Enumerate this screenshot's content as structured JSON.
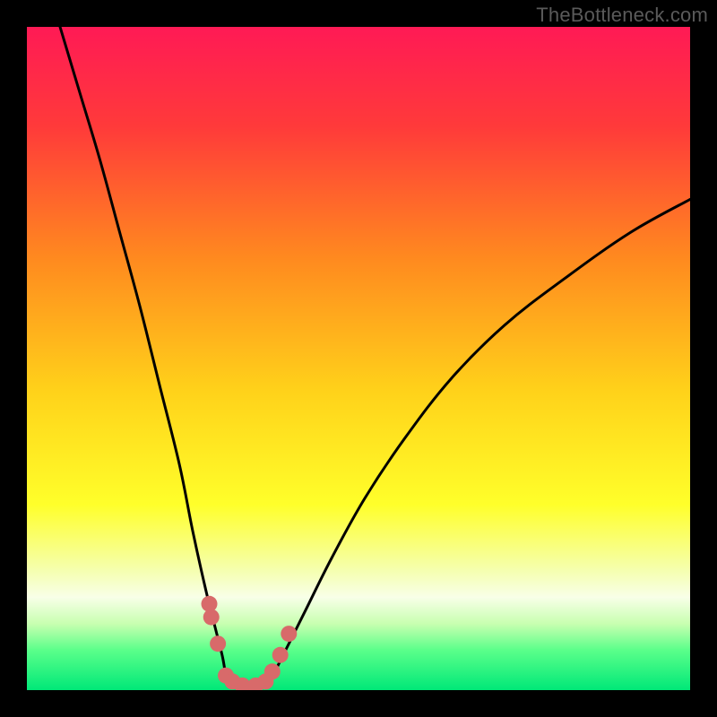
{
  "watermark": "TheBottleneck.com",
  "chart_data": {
    "type": "line",
    "title": "",
    "xlabel": "",
    "ylabel": "",
    "xlim": [
      0,
      100
    ],
    "ylim": [
      0,
      100
    ],
    "gradient_stops": [
      {
        "offset": 0,
        "color": "#ff1a55"
      },
      {
        "offset": 0.15,
        "color": "#ff3a3a"
      },
      {
        "offset": 0.35,
        "color": "#ff8a1f"
      },
      {
        "offset": 0.55,
        "color": "#ffd21a"
      },
      {
        "offset": 0.72,
        "color": "#ffff2a"
      },
      {
        "offset": 0.82,
        "color": "#f5ffb0"
      },
      {
        "offset": 0.86,
        "color": "#f8ffe8"
      },
      {
        "offset": 0.9,
        "color": "#c8ffb0"
      },
      {
        "offset": 0.94,
        "color": "#5aff8a"
      },
      {
        "offset": 1.0,
        "color": "#00e878"
      }
    ],
    "series": [
      {
        "name": "left-curve",
        "x": [
          5,
          8,
          11,
          14,
          17,
          20,
          23,
          25,
          27,
          28.5,
          29.5,
          30
        ],
        "y": [
          100,
          90,
          80,
          69,
          58,
          46,
          34,
          24,
          15,
          9,
          5,
          2
        ]
      },
      {
        "name": "right-curve",
        "x": [
          37,
          39,
          42,
          46,
          51,
          57,
          64,
          72,
          81,
          91,
          100
        ],
        "y": [
          2,
          6,
          12,
          20,
          29,
          38,
          47,
          55,
          62,
          69,
          74
        ]
      },
      {
        "name": "floor",
        "x": [
          30,
          31,
          32,
          33,
          34,
          35,
          36,
          37
        ],
        "y": [
          2,
          1,
          0.5,
          0.3,
          0.3,
          0.5,
          1,
          2
        ]
      }
    ],
    "markers": {
      "name": "outlier-dots",
      "color": "#d86a6a",
      "points": [
        {
          "x": 27.5,
          "y": 13
        },
        {
          "x": 27.8,
          "y": 11
        },
        {
          "x": 28.8,
          "y": 7
        },
        {
          "x": 30.0,
          "y": 2.2
        },
        {
          "x": 31.0,
          "y": 1.3
        },
        {
          "x": 32.5,
          "y": 0.7
        },
        {
          "x": 34.5,
          "y": 0.7
        },
        {
          "x": 36.0,
          "y": 1.3
        },
        {
          "x": 37.0,
          "y": 2.8
        },
        {
          "x": 38.2,
          "y": 5.3
        },
        {
          "x": 39.5,
          "y": 8.5
        }
      ]
    }
  }
}
